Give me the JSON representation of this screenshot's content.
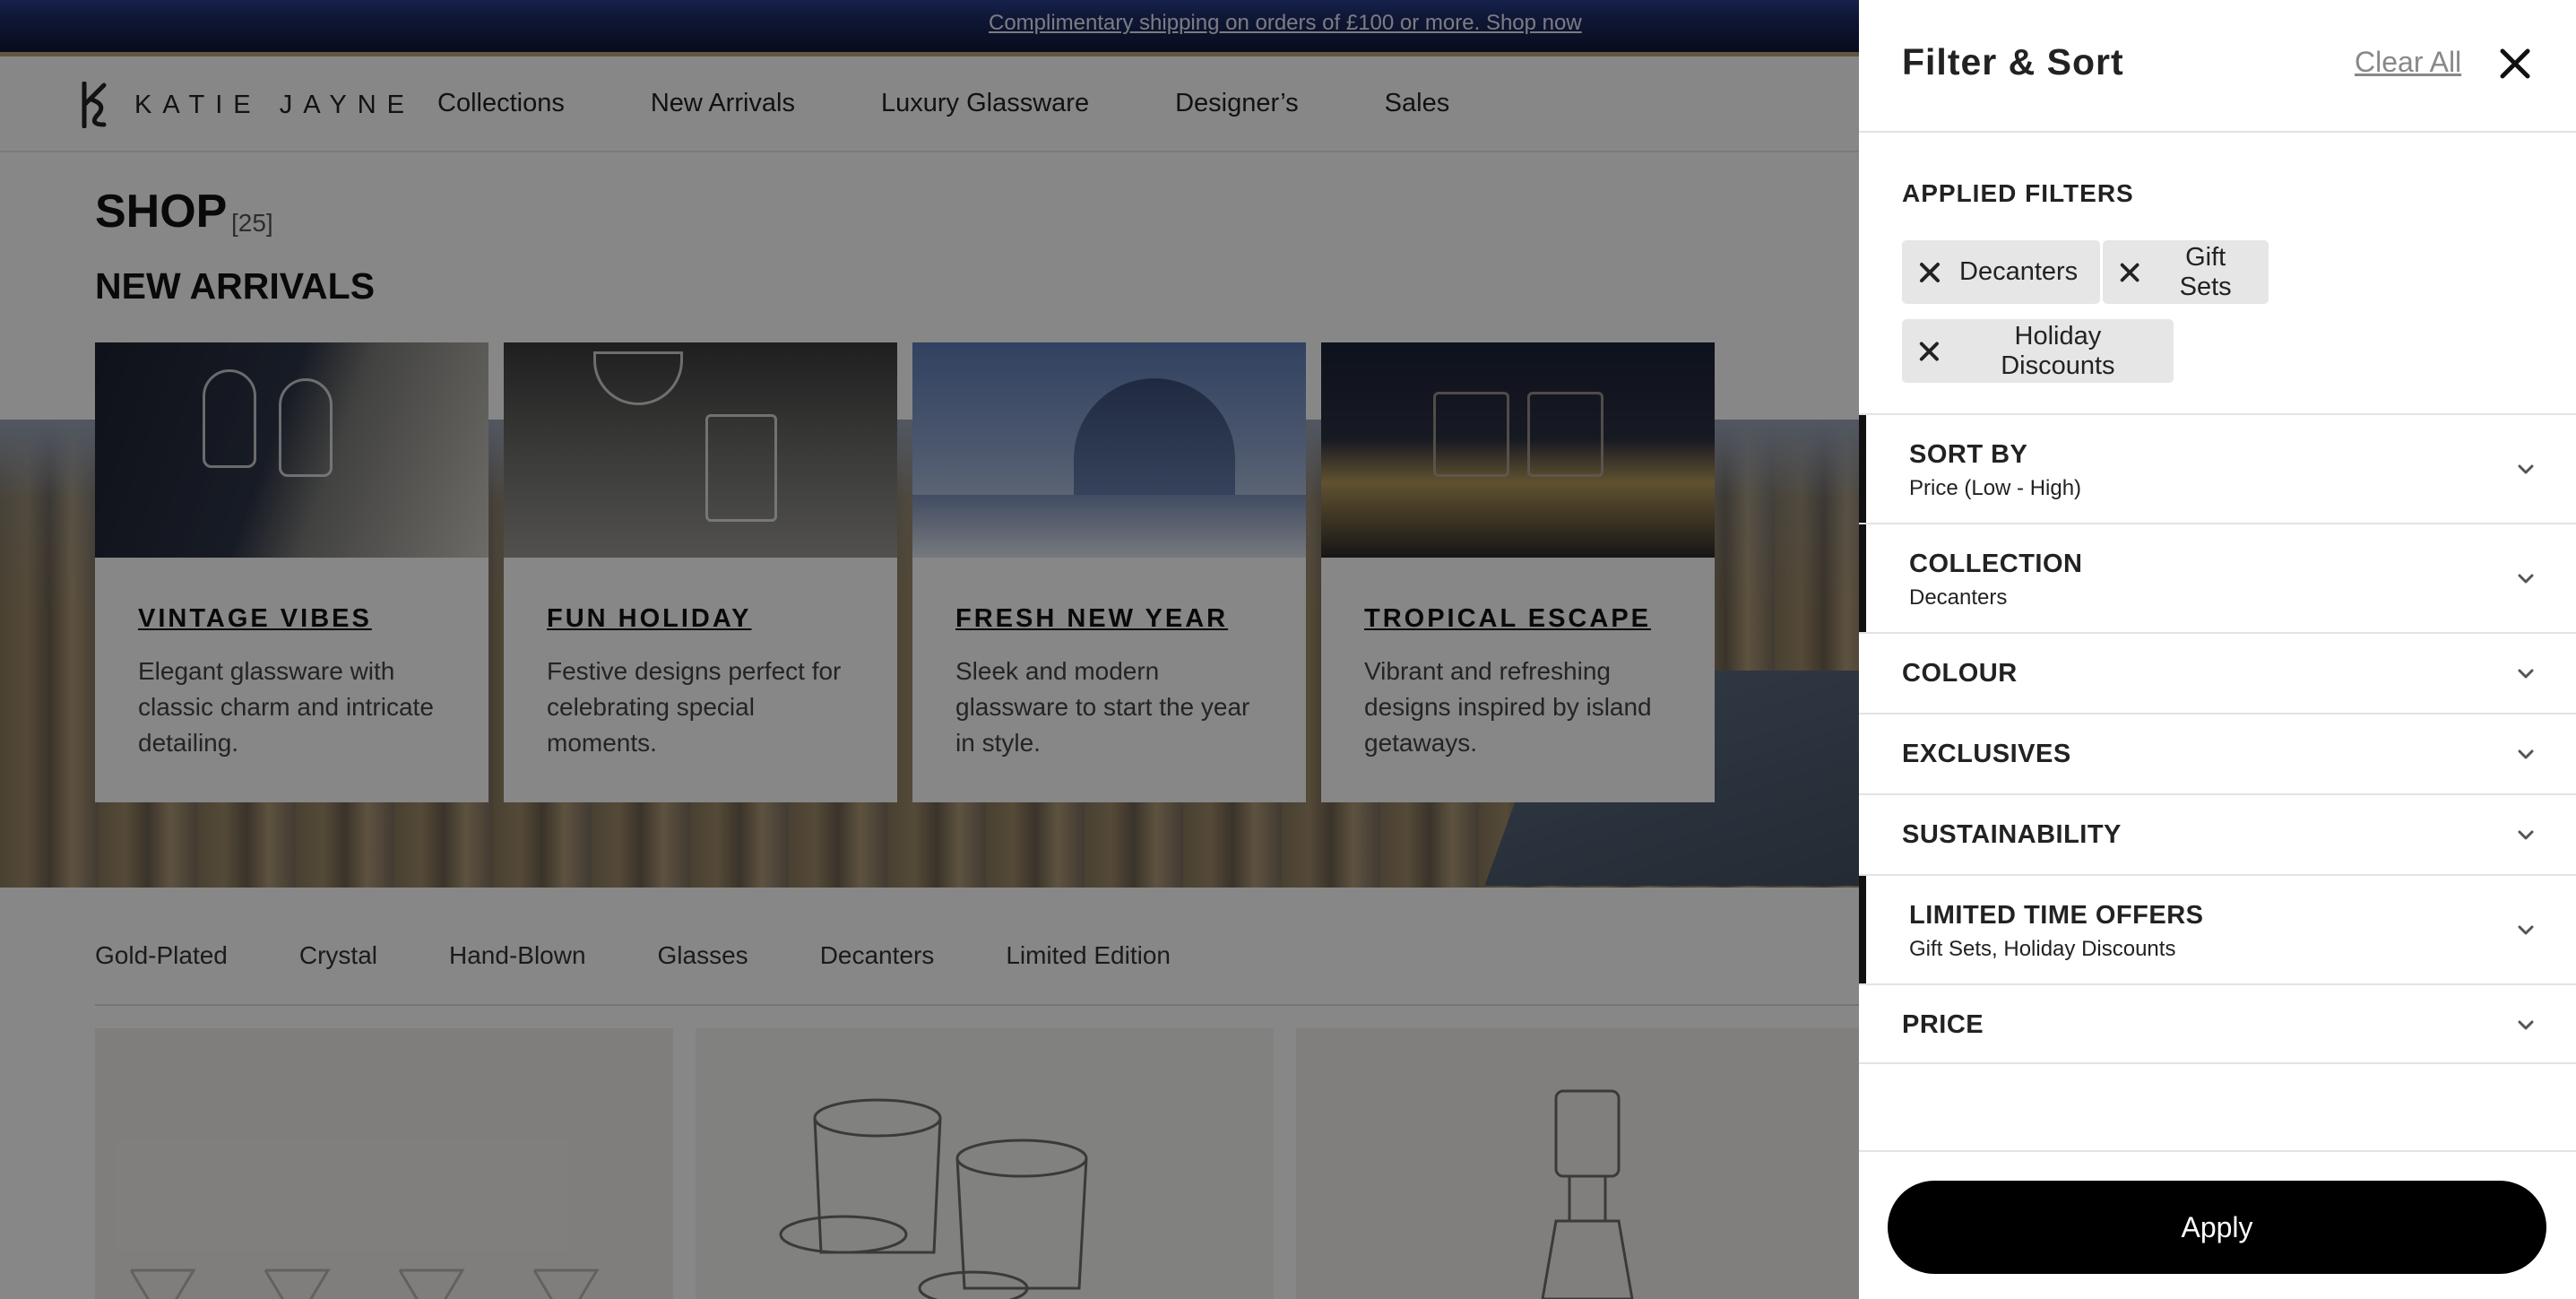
{
  "promo": {
    "text": "Complimentary shipping on orders of £100 or more. Shop now"
  },
  "header": {
    "logo_text": "KATIE JAYNE",
    "nav": [
      "Collections",
      "New Arrivals",
      "Luxury Glassware",
      "Designer’s",
      "Sales"
    ]
  },
  "shop": {
    "title": "SHOP",
    "count": "[25]",
    "section_title": "NEW ARRIVALS"
  },
  "cards": [
    {
      "title": "VINTAGE VIBES",
      "desc": "Elegant glassware with classic charm and intricate detailing."
    },
    {
      "title": "FUN HOLIDAY",
      "desc": "Festive designs perfect for celebrating special moments."
    },
    {
      "title": "FRESH NEW YEAR",
      "desc": "Sleek and modern glassware to start the year in style."
    },
    {
      "title": "TROPICAL ESCAPE",
      "desc": "Vibrant and refreshing designs inspired by island getaways."
    }
  ],
  "categories": [
    "Gold-Plated",
    "Crystal",
    "Hand-Blown",
    "Glasses",
    "Decanters",
    "Limited Edition"
  ],
  "drawer": {
    "title": "Filter & Sort",
    "clear_all": "Clear All",
    "applied_label": "APPLIED FILTERS",
    "chips": [
      "Decanters",
      "Gift Sets",
      "Holiday Discounts"
    ],
    "sections": [
      {
        "title": "SORT BY",
        "value": "Price (Low - High)"
      },
      {
        "title": "COLLECTION",
        "value": "Decanters"
      },
      {
        "title": "COLOUR",
        "value": ""
      },
      {
        "title": "EXCLUSIVES",
        "value": ""
      },
      {
        "title": "SUSTAINABILITY",
        "value": ""
      },
      {
        "title": "LIMITED TIME OFFERS",
        "value": "Gift Sets, Holiday Discounts"
      },
      {
        "title": "PRICE",
        "value": ""
      }
    ],
    "apply_label": "Apply"
  },
  "icons": {
    "close": "close-icon",
    "remove_chip": "x-icon",
    "expand": "chevron-down-icon"
  },
  "colors": {
    "promo_bg": "#1f2e6b",
    "overlay": "rgba(0,0,0,0.47)",
    "button": "#000000",
    "chip_bg": "#e6e6e6"
  }
}
